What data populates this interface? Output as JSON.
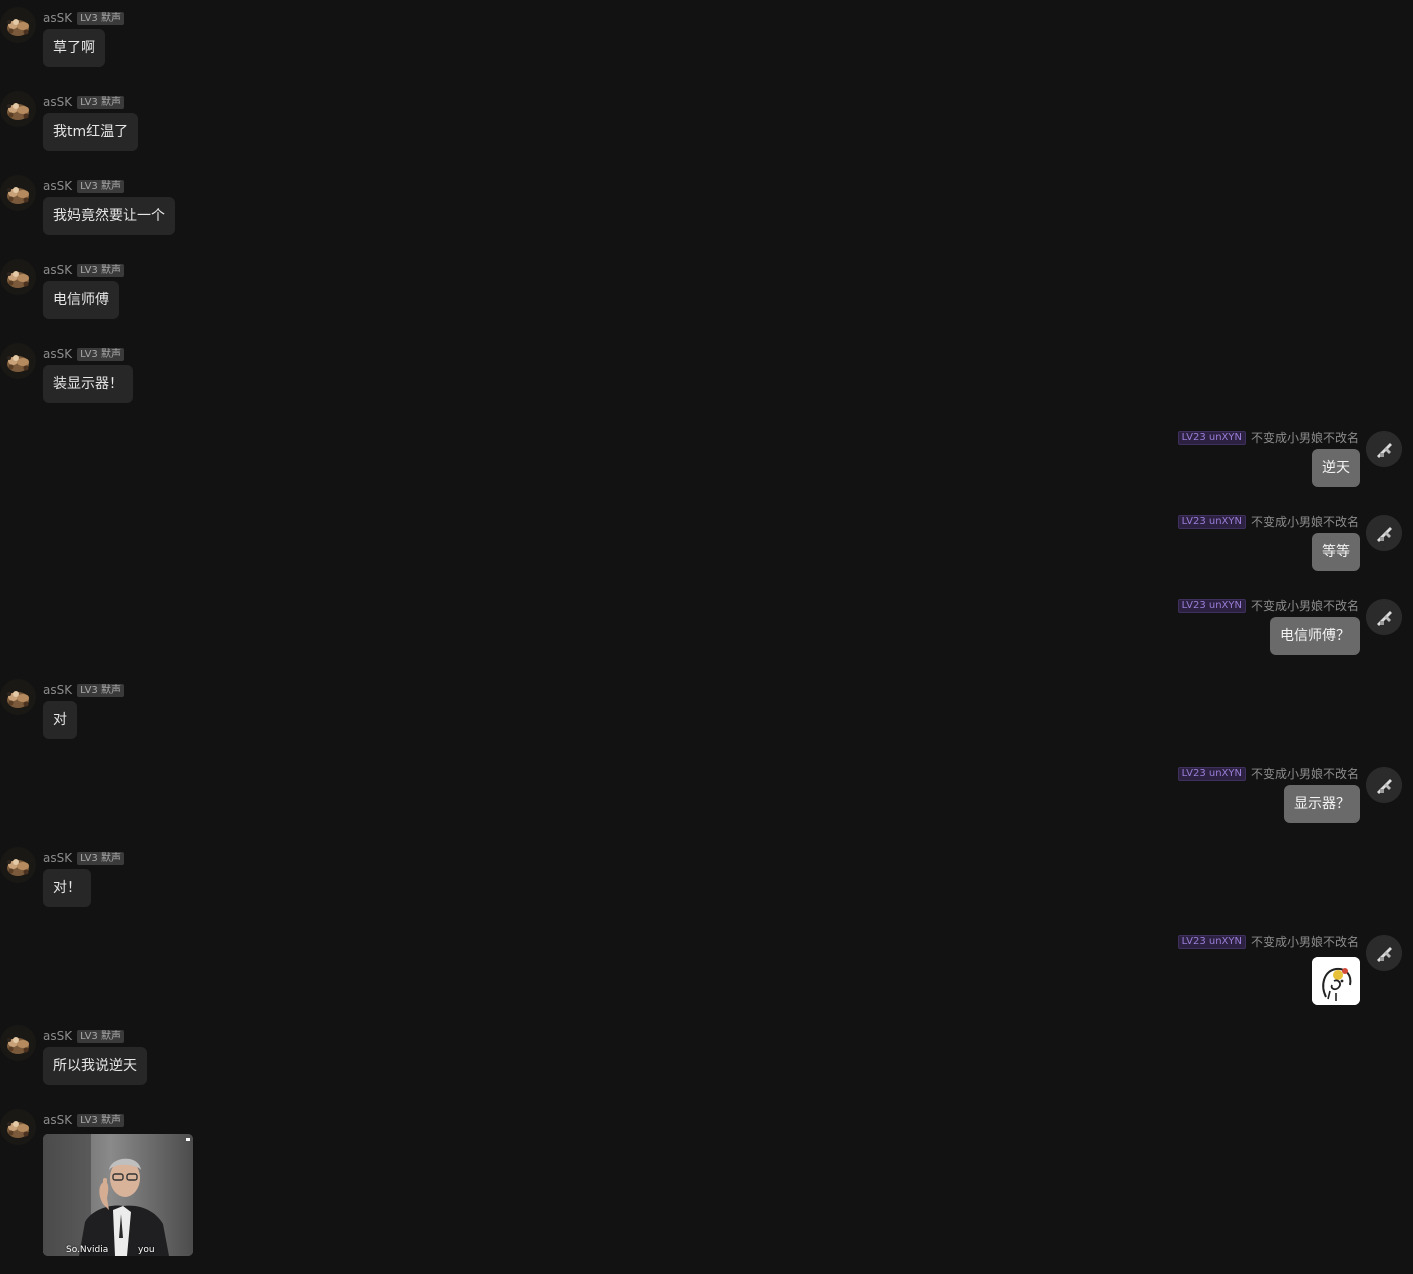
{
  "users": {
    "left": {
      "name": "asSK",
      "badge": "LV3 默声"
    },
    "right": {
      "name": "不变成小男娘不改名",
      "badge": "LV23 unXYN"
    }
  },
  "messages": [
    {
      "side": "left",
      "type": "text",
      "text": "草了啊"
    },
    {
      "side": "left",
      "type": "text",
      "text": "我tm红温了"
    },
    {
      "side": "left",
      "type": "text",
      "text": "我妈竟然要让一个"
    },
    {
      "side": "left",
      "type": "text",
      "text": "电信师傅"
    },
    {
      "side": "left",
      "type": "text",
      "text": "装显示器！"
    },
    {
      "side": "right",
      "type": "text",
      "text": "逆天"
    },
    {
      "side": "right",
      "type": "text",
      "text": "等等"
    },
    {
      "side": "right",
      "type": "text",
      "text": "电信师傅？"
    },
    {
      "side": "left",
      "type": "text",
      "text": "对"
    },
    {
      "side": "right",
      "type": "text",
      "text": "显示器？"
    },
    {
      "side": "left",
      "type": "text",
      "text": "对！"
    },
    {
      "side": "right",
      "type": "sticker",
      "icon": "meme-face-sticker"
    },
    {
      "side": "left",
      "type": "text",
      "text": "所以我说逆天"
    },
    {
      "side": "left",
      "type": "image",
      "caption_left": "So.Nvidia",
      "caption_right": "you",
      "icon": "man-gesturing-photo"
    }
  ],
  "colors": {
    "background": "#121212",
    "bubble_left": "#272727",
    "bubble_right": "#6a6a6a",
    "badge_gray": "#3a3a3a",
    "badge_purple_text": "#9a7ed8"
  }
}
